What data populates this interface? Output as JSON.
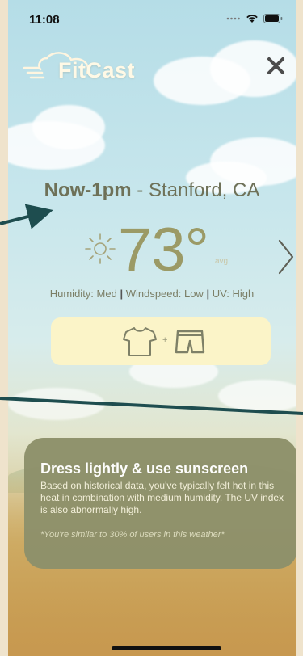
{
  "status": {
    "time": "11:08"
  },
  "app": {
    "name": "FitCast"
  },
  "forecast": {
    "period": "Now-1pm",
    "location": " - Stanford, CA",
    "temperature": "73°",
    "temp_qualifier": "avg",
    "humidity": "Humidity: Med",
    "windspeed": "Windspeed: Low",
    "uv": "UV: High",
    "separator": "|"
  },
  "outfit": {
    "plus": "+",
    "items": [
      "t-shirt-icon",
      "shorts-icon"
    ]
  },
  "advice": {
    "title": "Dress lightly & use sunscreen",
    "body": "Based on historical data, you've typically felt hot in this heat in combination with medium humidity. The UV index is also abnormally high.",
    "note": "*You're similar to 30% of users in this weather*"
  },
  "icons": {
    "close": "close-icon",
    "next": "chevron-right-icon",
    "weather": "sun-icon"
  },
  "colors": {
    "accent": "#9b9a66",
    "card": "#8e916b",
    "outfit_bg": "#fbf4c8",
    "arrow": "#1e4d4f"
  }
}
